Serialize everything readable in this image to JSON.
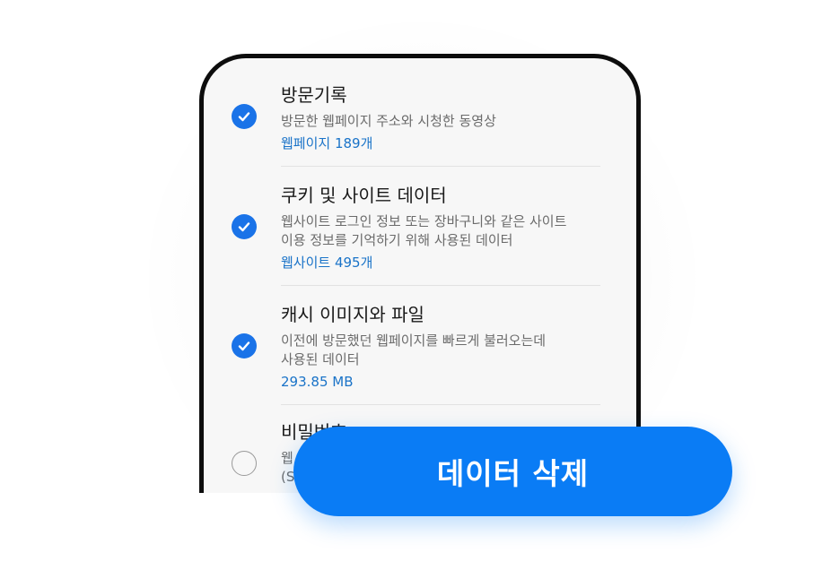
{
  "items": [
    {
      "title": "방문기록",
      "desc": [
        "방문한 웹페이지 주소와 시청한 동영상"
      ],
      "meta": "웹페이지 189개",
      "checked": true
    },
    {
      "title": "쿠키 및 사이트 데이터",
      "desc": [
        "웹사이트 로그인 정보 또는 장바구니와 같은 사이트",
        "이용 정보를 기억하기 위해 사용된 데이터"
      ],
      "meta": "웹사이트 495개",
      "checked": true
    },
    {
      "title": "캐시 이미지와 파일",
      "desc": [
        "이전에 방문했던 웹페이지를 빠르게 불러오는데",
        "사용된 데이터"
      ],
      "meta": "293.85 MB",
      "checked": true
    },
    {
      "title": "비밀번호",
      "desc": [
        "웹",
        "(S"
      ],
      "meta": "...",
      "checked": false
    }
  ],
  "delete_button": {
    "label": "데이터 삭제"
  },
  "colors": {
    "accent": "#0a7cf5",
    "check": "#1a73e8",
    "meta_text": "#1a73c8"
  }
}
